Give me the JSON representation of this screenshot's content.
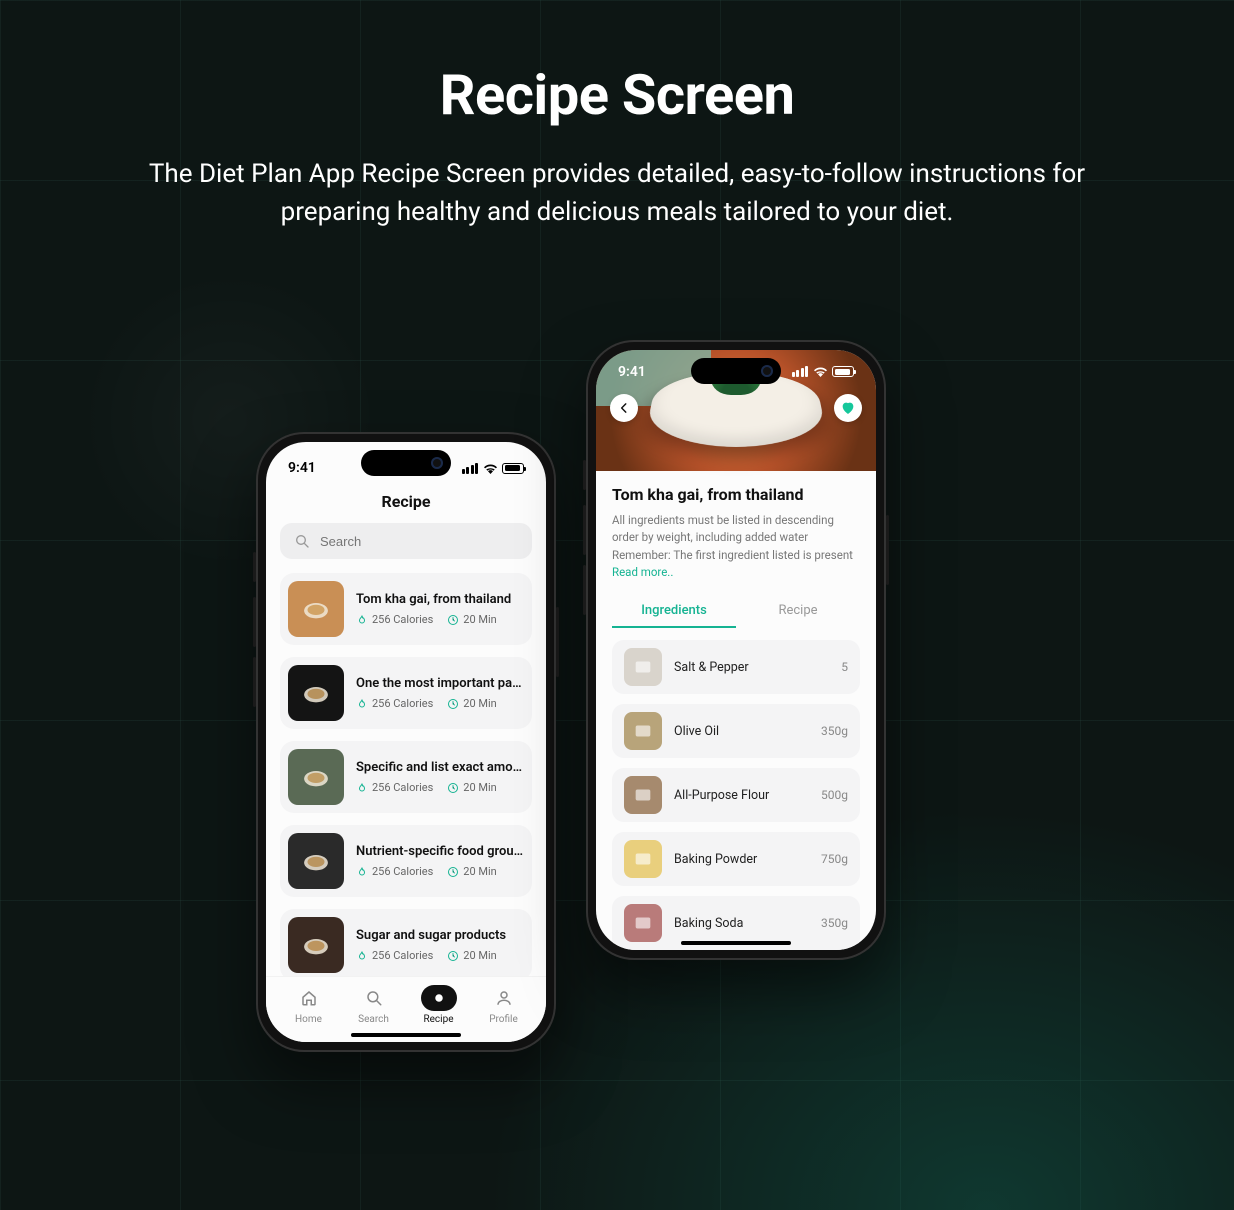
{
  "hero": {
    "title": "Recipe Screen",
    "subtitle": "The Diet Plan App Recipe Screen provides detailed, easy-to-follow instructions for preparing healthy and delicious meals tailored to your diet."
  },
  "status_time": "9:41",
  "left": {
    "title": "Recipe",
    "search_placeholder": "Search",
    "recipes": [
      {
        "name": "Tom kha gai, from thailand",
        "calories": "256 Calories",
        "time": "20 Min",
        "thumb_bg": "#c98f55"
      },
      {
        "name": "One the most important parts",
        "calories": "256 Calories",
        "time": "20 Min",
        "thumb_bg": "#141414"
      },
      {
        "name": "Specific and list exact amounts",
        "calories": "256 Calories",
        "time": "20 Min",
        "thumb_bg": "#5a6a55"
      },
      {
        "name": "Nutrient-specific food groups",
        "calories": "256 Calories",
        "time": "20 Min",
        "thumb_bg": "#2a2a2a"
      },
      {
        "name": "Sugar and sugar products",
        "calories": "256 Calories",
        "time": "20 Min",
        "thumb_bg": "#3a2a22"
      }
    ],
    "nav": [
      {
        "label": "Home",
        "icon": "home"
      },
      {
        "label": "Search",
        "icon": "search"
      },
      {
        "label": "Recipe",
        "icon": "recipe",
        "active": true
      },
      {
        "label": "Profile",
        "icon": "profile"
      }
    ]
  },
  "right": {
    "title": "Tom kha gai, from thailand",
    "description": "All ingredients must be listed in descending order by weight, including added water Remember: The first ingredient listed is present ",
    "read_more": "Read more..",
    "tabs": [
      {
        "label": "Ingredients",
        "active": true
      },
      {
        "label": "Recipe",
        "active": false
      }
    ],
    "ingredients": [
      {
        "name": "Salt & Pepper",
        "amount": "5",
        "thumb_bg": "#d9d4cc"
      },
      {
        "name": "Olive Oil",
        "amount": "350g",
        "thumb_bg": "#b8a47a"
      },
      {
        "name": "All-Purpose Flour",
        "amount": "500g",
        "thumb_bg": "#a68a6e"
      },
      {
        "name": "Baking Powder",
        "amount": "750g",
        "thumb_bg": "#e9cf7d"
      },
      {
        "name": "Baking Soda",
        "amount": "350g",
        "thumb_bg": "#b97b7a"
      }
    ]
  }
}
